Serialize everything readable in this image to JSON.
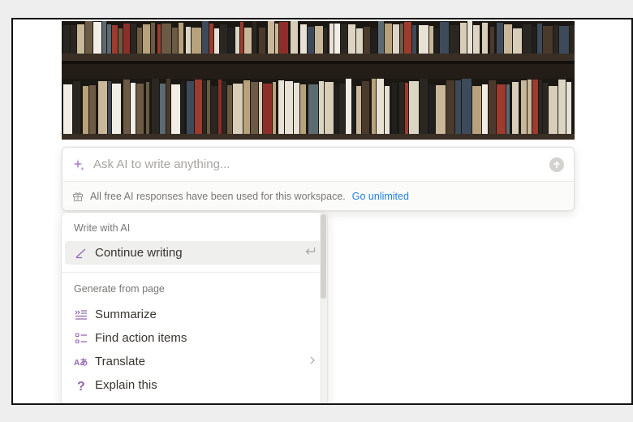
{
  "ai_prompt": {
    "placeholder": "Ask AI to write anything...",
    "notice": "All free AI responses have been used for this workspace.",
    "upgrade_link": "Go unlimited"
  },
  "menu": {
    "sections": [
      {
        "title": "Write with AI",
        "items": [
          {
            "label": "Continue writing",
            "icon": "pencil-icon",
            "shortcut_icon": "enter-return-icon"
          }
        ]
      },
      {
        "title": "Generate from page",
        "items": [
          {
            "label": "Summarize",
            "icon": "summarize-icon"
          },
          {
            "label": "Find action items",
            "icon": "checklist-icon"
          },
          {
            "label": "Translate",
            "icon": "translate-icon",
            "submenu_icon": "chevron-right-icon"
          },
          {
            "label": "Explain this",
            "icon": "question-icon"
          }
        ]
      }
    ]
  },
  "colors": {
    "accent_purple": "#9065b0",
    "link_blue": "#2383e2",
    "text": "#37352f",
    "muted": "#787774"
  }
}
